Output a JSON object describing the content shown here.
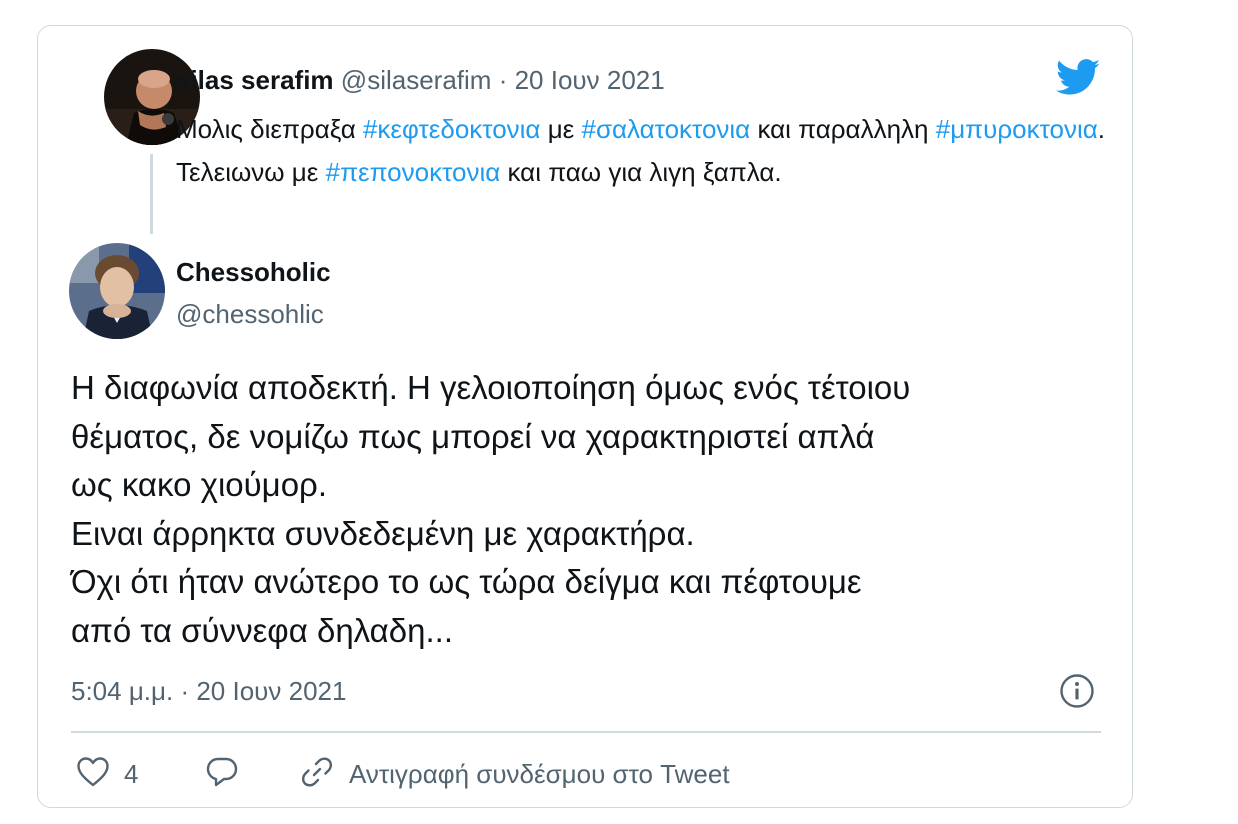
{
  "parent_tweet": {
    "display_name": "silas serafim",
    "handle": "@silaserafim",
    "separator": "·",
    "date": "20 Ιουν 2021",
    "text_segments": [
      {
        "text": "Μολις διεπραξα ",
        "hashtag": false
      },
      {
        "text": "#κεφτεδοκτονια",
        "hashtag": true
      },
      {
        "text": " με ",
        "hashtag": false
      },
      {
        "text": "#σαλατοκτονια",
        "hashtag": true
      },
      {
        "text": " και παραλληλη ",
        "hashtag": false
      },
      {
        "text": "#μπυροκτονια",
        "hashtag": true
      },
      {
        "text": ". Τελειωνω με ",
        "hashtag": false
      },
      {
        "text": "#πεπονοκτονια",
        "hashtag": true
      },
      {
        "text": " και παω για λιγη ξαπλα.",
        "hashtag": false
      }
    ]
  },
  "reply_tweet": {
    "display_name": "Chessoholic",
    "handle": "@chessohlic",
    "text_lines": [
      "Η διαφωνία αποδεκτή. Η γελοιοποίηση όμως ενός τέτοιου",
      "θέματος, δε νομίζω πως μπορεί να χαρακτηριστεί απλά",
      "ως κακο χιούμορ.",
      "Ειναι άρρηκτα συνδεδεμένη με χαρακτήρα.",
      "Όχι ότι ήταν ανώτερο το ως τώρα δείγμα και πέφτουμε",
      "από τα σύννεφα δηλαδη..."
    ],
    "timestamp": "5:04 μ.μ. · 20 Ιουν 2021"
  },
  "actions": {
    "like_count": "4",
    "copy_link_label": "Αντιγραφή συνδέσμου στο Tweet"
  },
  "icons": {
    "brand": "twitter-bird-icon",
    "info": "info-icon",
    "like": "heart-icon",
    "reply": "reply-bubble-icon",
    "copy": "link-icon"
  },
  "colors": {
    "brand_blue": "#1d9bf0",
    "text_primary": "#0f1419",
    "text_secondary": "#536471",
    "border": "#cfd9de"
  }
}
